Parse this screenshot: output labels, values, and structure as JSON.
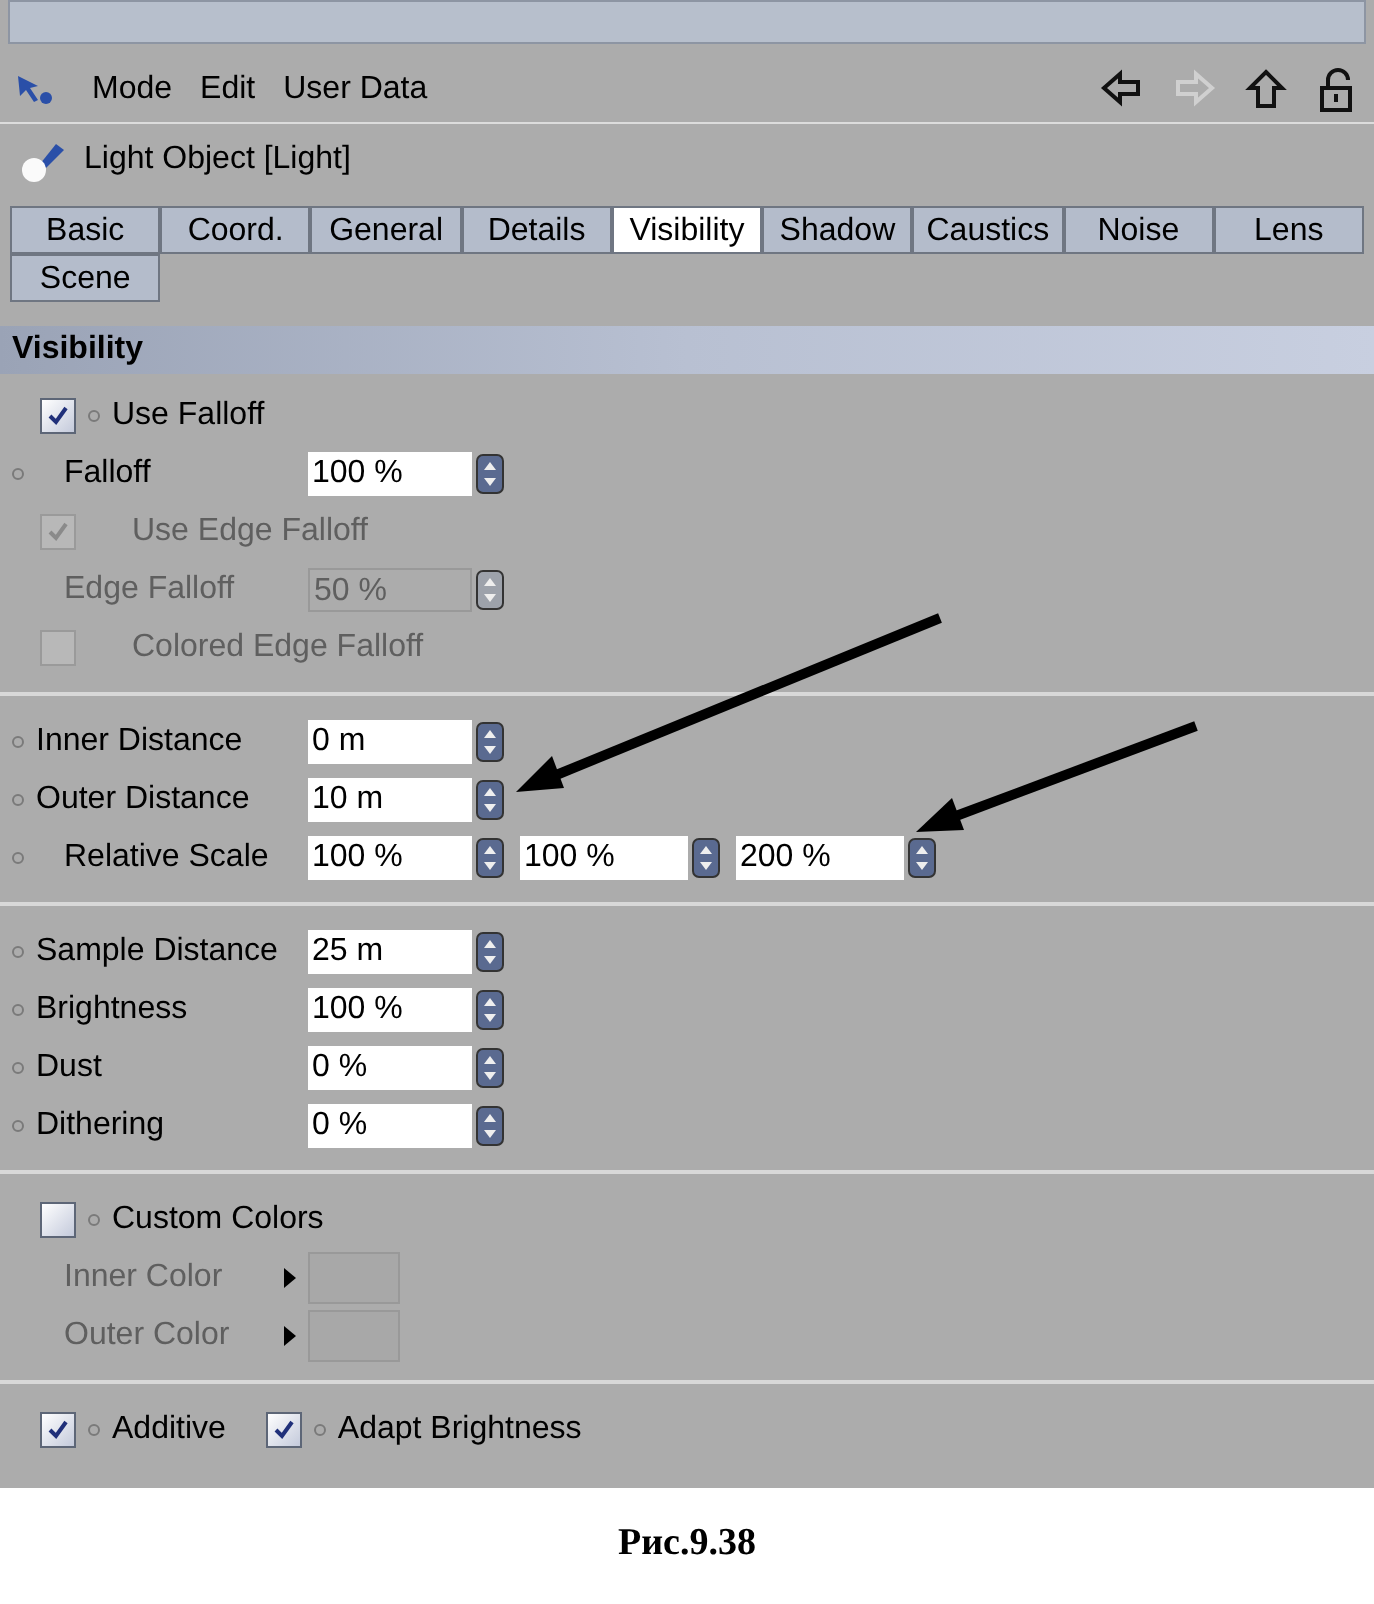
{
  "menu": [
    "Mode",
    "Edit",
    "User Data"
  ],
  "object_title": "Light Object [Light]",
  "tabs": [
    {
      "label": "Basic",
      "selected": false
    },
    {
      "label": "Coord.",
      "selected": false
    },
    {
      "label": "General",
      "selected": false
    },
    {
      "label": "Details",
      "selected": false
    },
    {
      "label": "Visibility",
      "selected": true
    },
    {
      "label": "Shadow",
      "selected": false
    },
    {
      "label": "Caustics",
      "selected": false
    },
    {
      "label": "Noise",
      "selected": false
    },
    {
      "label": "Lens",
      "selected": false
    },
    {
      "label": "Scene",
      "selected": false
    }
  ],
  "section_title": "Visibility",
  "groups": [
    {
      "rows": [
        {
          "kind": "checkbox",
          "label": "Use Falloff",
          "checked": true,
          "disabled": false,
          "animatable": true
        },
        {
          "kind": "number",
          "label": "Falloff",
          "values": [
            "100 %"
          ],
          "disabled": false,
          "animatable": true,
          "indent": true
        },
        {
          "kind": "checkbox",
          "label": "Use Edge Falloff",
          "checked": true,
          "disabled": true,
          "animatable": false
        },
        {
          "kind": "number",
          "label": "Edge Falloff",
          "values": [
            "50 %"
          ],
          "disabled": true,
          "animatable": false,
          "indent": true
        },
        {
          "kind": "checkbox",
          "label": "Colored Edge Falloff",
          "checked": false,
          "disabled": true,
          "animatable": false
        }
      ]
    },
    {
      "rows": [
        {
          "kind": "number",
          "label": "Inner Distance",
          "values": [
            "0 m"
          ],
          "disabled": false,
          "animatable": true,
          "indent": false
        },
        {
          "kind": "number",
          "label": "Outer Distance",
          "values": [
            "10 m"
          ],
          "disabled": false,
          "animatable": true,
          "indent": false
        },
        {
          "kind": "number",
          "label": "Relative Scale",
          "values": [
            "100 %",
            "100 %",
            "200 %"
          ],
          "disabled": false,
          "animatable": true,
          "indent": true
        }
      ]
    },
    {
      "rows": [
        {
          "kind": "number",
          "label": "Sample Distance",
          "values": [
            "25 m"
          ],
          "disabled": false,
          "animatable": true,
          "indent": false
        },
        {
          "kind": "number",
          "label": "Brightness",
          "values": [
            "100 %"
          ],
          "disabled": false,
          "animatable": true,
          "indent": false
        },
        {
          "kind": "number",
          "label": "Dust",
          "values": [
            "0 %"
          ],
          "disabled": false,
          "animatable": true,
          "indent": false
        },
        {
          "kind": "number",
          "label": "Dithering",
          "values": [
            "0 %"
          ],
          "disabled": false,
          "animatable": true,
          "indent": false
        }
      ]
    },
    {
      "rows": [
        {
          "kind": "checkbox",
          "label": "Custom Colors",
          "checked": false,
          "disabled": false,
          "animatable": true
        },
        {
          "kind": "color",
          "label": "Inner Color",
          "disabled": true
        },
        {
          "kind": "color",
          "label": "Outer Color",
          "disabled": true
        }
      ]
    },
    {
      "rows": [
        {
          "kind": "checkbox_pair",
          "items": [
            {
              "label": "Additive",
              "checked": true
            },
            {
              "label": "Adapt Brightness",
              "checked": true
            }
          ]
        }
      ]
    }
  ],
  "caption": "Рис.9.38"
}
